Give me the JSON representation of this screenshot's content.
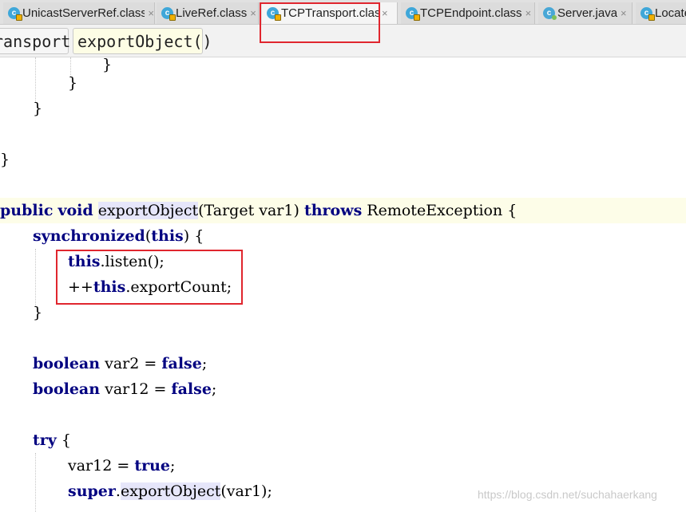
{
  "tabs": [
    {
      "label": "UnicastServerRef.class",
      "icon": "class-file-icon",
      "active": false
    },
    {
      "label": "LiveRef.class",
      "icon": "class-file-icon",
      "active": false
    },
    {
      "label": "TCPTransport.class",
      "icon": "class-file-icon",
      "active": true
    },
    {
      "label": "TCPEndpoint.class",
      "icon": "class-file-icon",
      "active": false
    },
    {
      "label": "Server.java",
      "icon": "java-file-icon",
      "active": false
    },
    {
      "label": "Locate",
      "icon": "class-file-icon",
      "active": false
    }
  ],
  "close_glyph": "×",
  "breadcrumb": {
    "class_name": "ransport",
    "method_name": "exportObject()"
  },
  "code": {
    "l1": "}",
    "l2": "}",
    "l3": "}",
    "l4": "}",
    "sig": {
      "kw1": "public",
      "kw2": "void",
      "method": "exportObject",
      "params": "(Target var1) ",
      "kw3": "throws",
      "rest": " RemoteException {"
    },
    "sync": {
      "kw": "synchronized",
      "open": "(",
      "kw2": "this",
      "close": ") {"
    },
    "listen": {
      "kw": "this",
      "rest": ".listen();"
    },
    "incr": {
      "op": "++",
      "kw": "this",
      "rest": ".exportCount;"
    },
    "sync_end": "}",
    "var2": {
      "kw": "boolean",
      "mid": " var2 = ",
      "val": "false",
      "end": ";"
    },
    "var12": {
      "kw": "boolean",
      "mid": " var12 = ",
      "val": "false",
      "end": ";"
    },
    "try": {
      "kw": "try",
      "rest": " {"
    },
    "assign": {
      "name": "var12 = ",
      "val": "true",
      "end": ";"
    },
    "super": {
      "kw": "super",
      "dot": ".",
      "method": "exportObject",
      "rest": "(var1);"
    }
  },
  "watermark": "https://blog.csdn.net/suchahaerkang",
  "colors": {
    "keyword": "#000080",
    "annotation_box": "#e0262e",
    "usage_highlight": "#e6e6fa",
    "current_line": "#fdfde8"
  }
}
